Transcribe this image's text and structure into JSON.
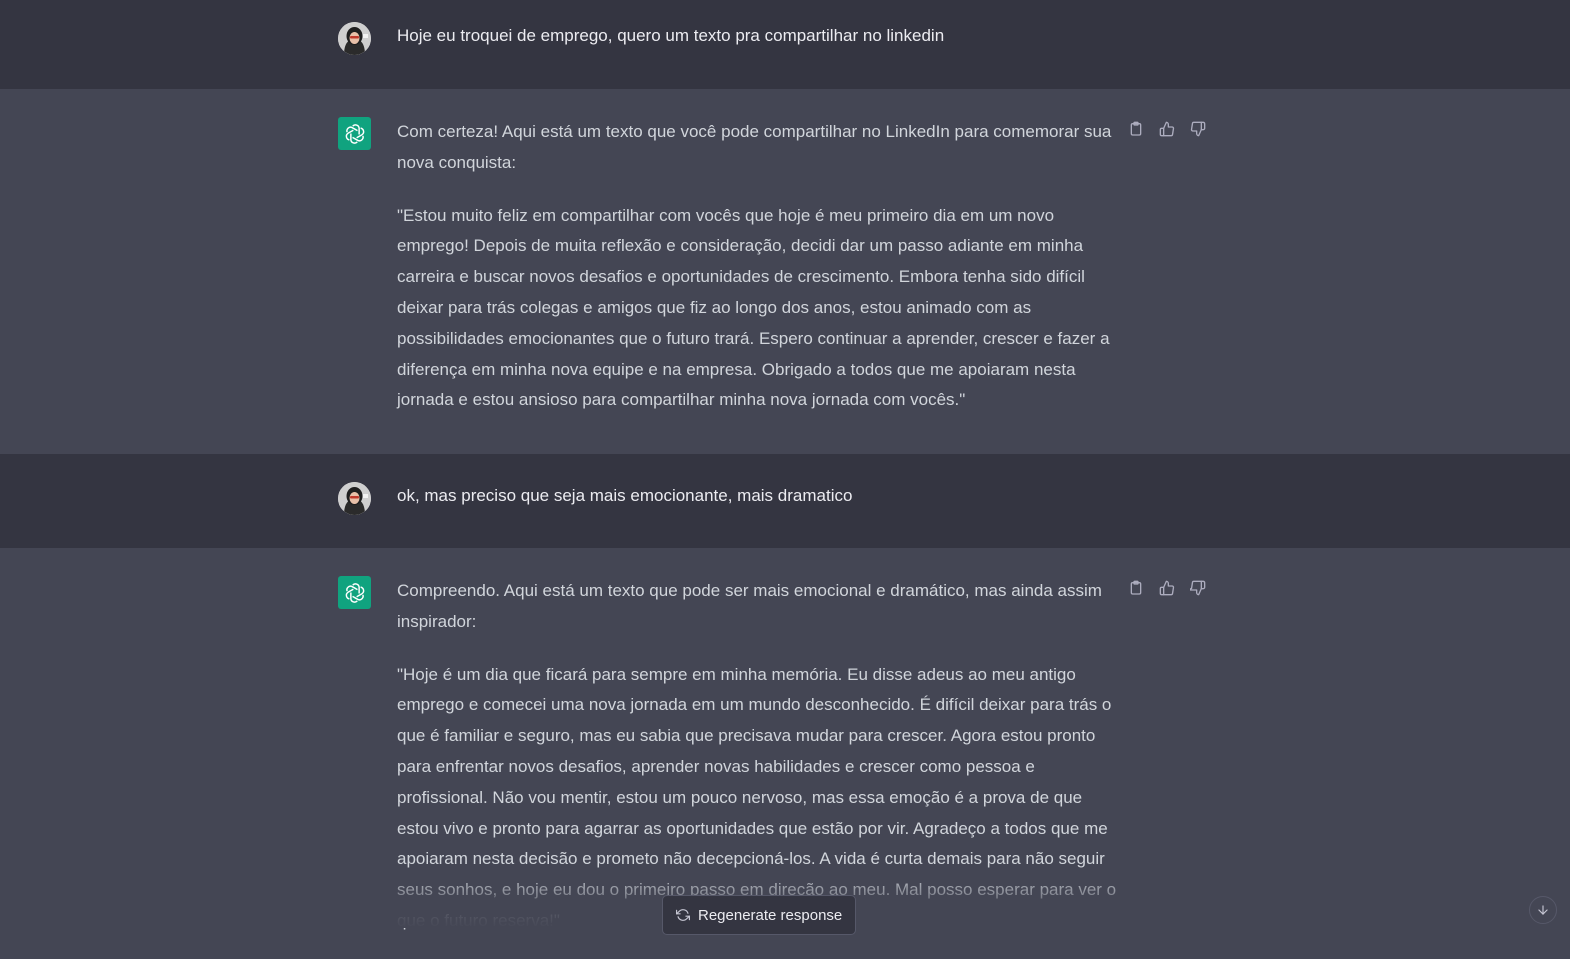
{
  "conversation": [
    {
      "role": "user",
      "text": "Hoje eu troquei de emprego, quero um texto pra compartilhar no linkedin"
    },
    {
      "role": "assistant",
      "intro": "Com certeza! Aqui está um texto que você pode compartilhar no LinkedIn para comemorar sua nova conquista:",
      "body": "\"Estou muito feliz em compartilhar com vocês que hoje é meu primeiro dia em um novo emprego! Depois de muita reflexão e consideração, decidi dar um passo adiante em minha carreira e buscar novos desafios e oportunidades de crescimento. Embora tenha sido difícil deixar para trás colegas e amigos que fiz ao longo dos anos, estou animado com as possibilidades emocionantes que o futuro trará. Espero continuar a aprender, crescer e fazer a diferença em minha nova equipe e na empresa. Obrigado a todos que me apoiaram nesta jornada e estou ansioso para compartilhar minha nova jornada com vocês.\""
    },
    {
      "role": "user",
      "text": "ok, mas preciso que seja mais emocionante, mais dramatico"
    },
    {
      "role": "assistant",
      "intro": "Compreendo. Aqui está um texto que pode ser mais emocional e dramático, mas ainda assim inspirador:",
      "body": "\"Hoje é um dia que ficará para sempre em minha memória. Eu disse adeus ao meu antigo emprego e comecei uma nova jornada em um mundo desconhecido. É difícil deixar para trás o que é familiar e seguro, mas eu sabia que precisava mudar para crescer. Agora estou pronto para enfrentar novos desafios, aprender novas habilidades e crescer como pessoa e profissional. Não vou mentir, estou um pouco nervoso, mas essa emoção é a prova de que estou vivo e pronto para agarrar as oportunidades que estão por vir. Agradeço a todos que me apoiaram nesta decisão e prometo não decepcioná-los. A vida é curta demais para não seguir seus sonhos, e hoje eu dou o primeiro passo em direção ao meu. Mal posso esperar para ver o que o futuro reserva!\""
    }
  ],
  "actions": {
    "copy_icon": "clipboard-icon",
    "like_icon": "thumbs-up-icon",
    "dislike_icon": "thumbs-down-icon"
  },
  "footer": {
    "regenerate_label": "Regenerate response"
  },
  "colors": {
    "user_bg": "#343541",
    "assistant_bg": "#444654",
    "brand": "#10a37f"
  }
}
